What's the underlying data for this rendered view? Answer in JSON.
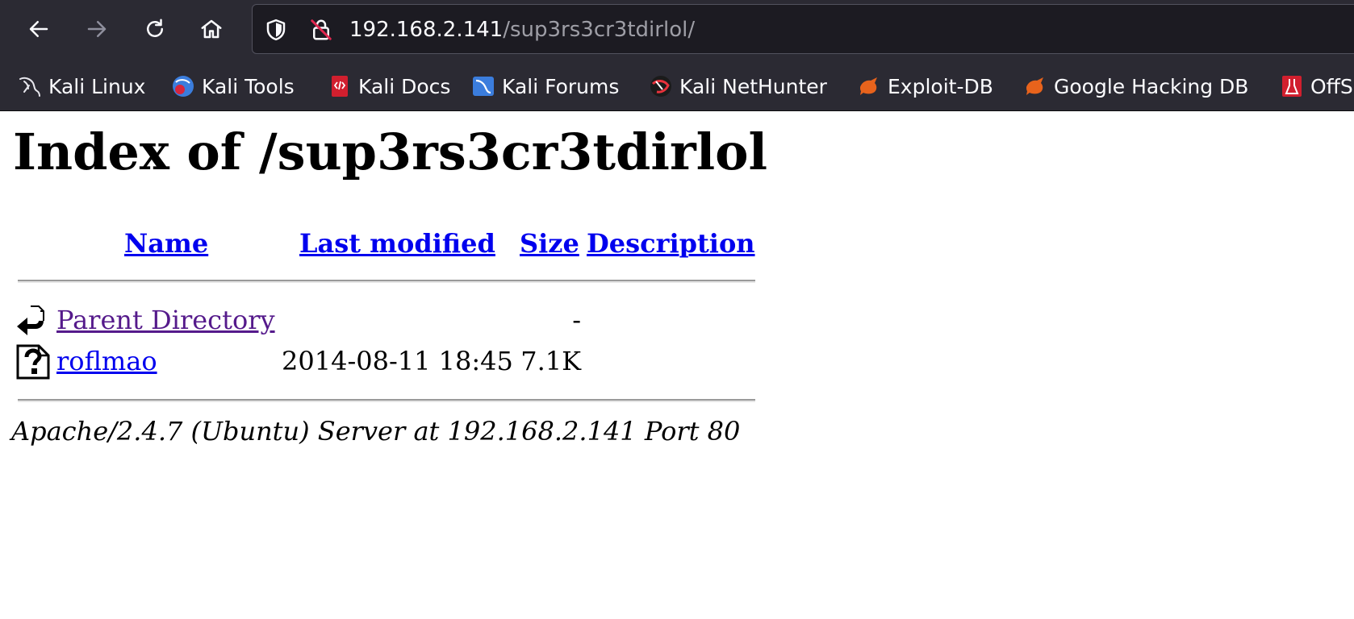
{
  "browser": {
    "url": {
      "host": "192.168.2.141",
      "path": "/sup3rs3cr3tdirlol/"
    },
    "nav_icons": [
      "back-arrow-icon",
      "forward-arrow-icon",
      "reload-icon",
      "home-icon"
    ],
    "bookmarks": [
      {
        "label": "Kali Linux",
        "icon": "kali-dragon-icon"
      },
      {
        "label": "Kali Tools",
        "icon": "kali-tools-icon"
      },
      {
        "label": "Kali Docs",
        "icon": "kali-docs-icon"
      },
      {
        "label": "Kali Forums",
        "icon": "kali-forums-icon"
      },
      {
        "label": "Kali NetHunter",
        "icon": "kali-nethunter-icon"
      },
      {
        "label": "Exploit-DB",
        "icon": "exploit-db-icon"
      },
      {
        "label": "Google Hacking DB",
        "icon": "google-hacking-db-icon"
      },
      {
        "label": "OffS",
        "icon": "offsec-icon"
      }
    ],
    "colors": {
      "toolbar": "#2b2a33",
      "urlbar": "#1c1b22",
      "url_path": "#9e9ea6"
    }
  },
  "page": {
    "title": "Index of /sup3rs3cr3tdirlol",
    "columns": {
      "name": "Name",
      "modified": "Last modified",
      "size": "Size",
      "description": "Description"
    },
    "rows": [
      {
        "name": "Parent Directory",
        "modified": "",
        "size": "-",
        "icon": "back-folder-icon"
      },
      {
        "name": "roflmao",
        "modified": "2014-08-11 18:45",
        "size": "7.1K",
        "icon": "unknown-file-icon"
      }
    ],
    "footer": "Apache/2.4.7 (Ubuntu) Server at 192.168.2.141 Port 80",
    "colors": {
      "link": "#0000ee",
      "visited": "#551a8b"
    }
  }
}
